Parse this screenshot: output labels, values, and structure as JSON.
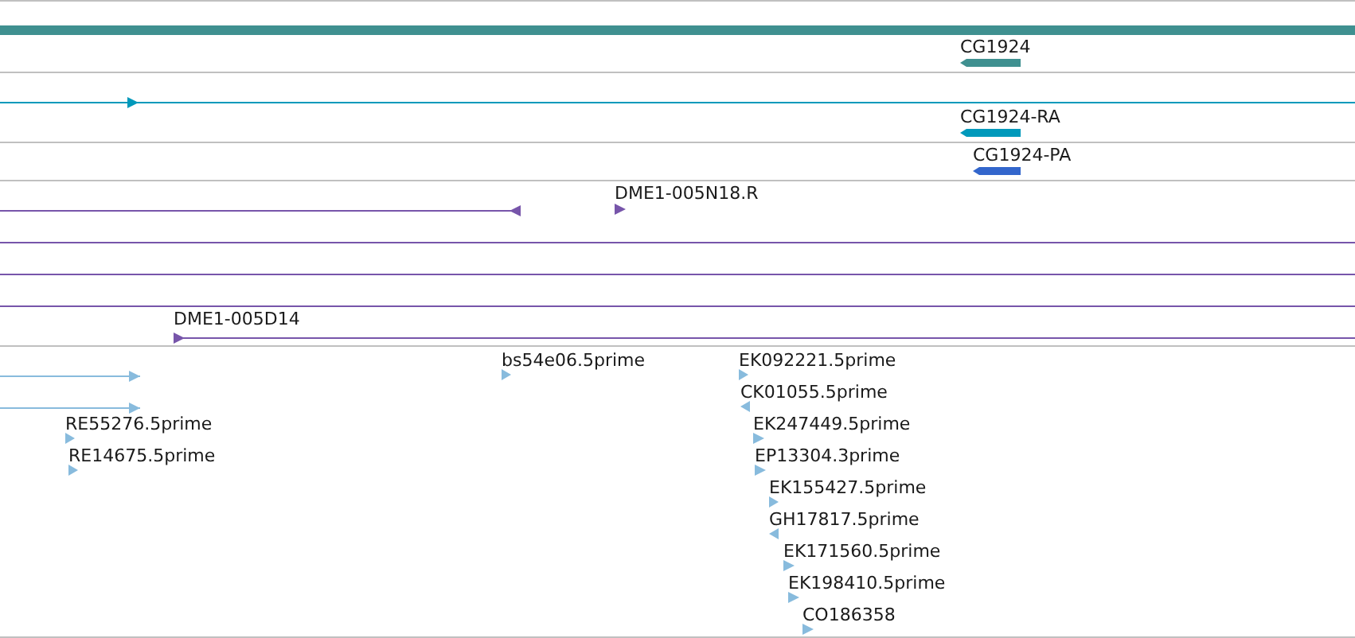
{
  "tracks": [
    {
      "color": "#3f9090",
      "features": [
        {
          "kind": "band"
        },
        {
          "kind": "block",
          "label": "CG1924",
          "reverse": true
        }
      ]
    },
    {
      "color": "#0099bb",
      "features": [
        {
          "kind": "line",
          "reverse": false
        },
        {
          "kind": "block",
          "label": "CG1924-RA",
          "reverse": true
        }
      ]
    },
    {
      "color": "#3366cc",
      "features": [
        {
          "kind": "block",
          "label": "CG1924-PA",
          "reverse": true
        }
      ]
    },
    {
      "color": "#7755aa",
      "features": [
        {
          "kind": "line",
          "reverse": true
        },
        {
          "kind": "marker",
          "label": "DME1-005N18.R",
          "reverse": false
        },
        {
          "kind": "line"
        },
        {
          "kind": "line"
        },
        {
          "kind": "line"
        },
        {
          "kind": "line",
          "label": "DME1-005D14",
          "reverse": false
        }
      ]
    },
    {
      "color": "#88bbdd",
      "features": [
        {
          "kind": "line",
          "reverse": false
        },
        {
          "kind": "marker",
          "label": "bs54e06.5prime",
          "reverse": false
        },
        {
          "kind": "marker",
          "label": "EK092221.5prime",
          "reverse": false
        },
        {
          "kind": "line",
          "reverse": false
        },
        {
          "kind": "marker",
          "label": "CK01055.5prime",
          "reverse": true
        },
        {
          "kind": "marker",
          "label": "RE55276.5prime",
          "reverse": false
        },
        {
          "kind": "marker",
          "label": "EK247449.5prime",
          "reverse": false
        },
        {
          "kind": "marker",
          "label": "RE14675.5prime",
          "reverse": false
        },
        {
          "kind": "marker",
          "label": "EP13304.3prime",
          "reverse": false
        },
        {
          "kind": "marker",
          "label": "EK155427.5prime",
          "reverse": false
        },
        {
          "kind": "marker",
          "label": "GH17817.5prime",
          "reverse": true
        },
        {
          "kind": "marker",
          "label": "EK171560.5prime",
          "reverse": false
        },
        {
          "kind": "marker",
          "label": "EK198410.5prime",
          "reverse": false
        },
        {
          "kind": "marker",
          "label": "CO186358",
          "reverse": false
        }
      ]
    }
  ]
}
